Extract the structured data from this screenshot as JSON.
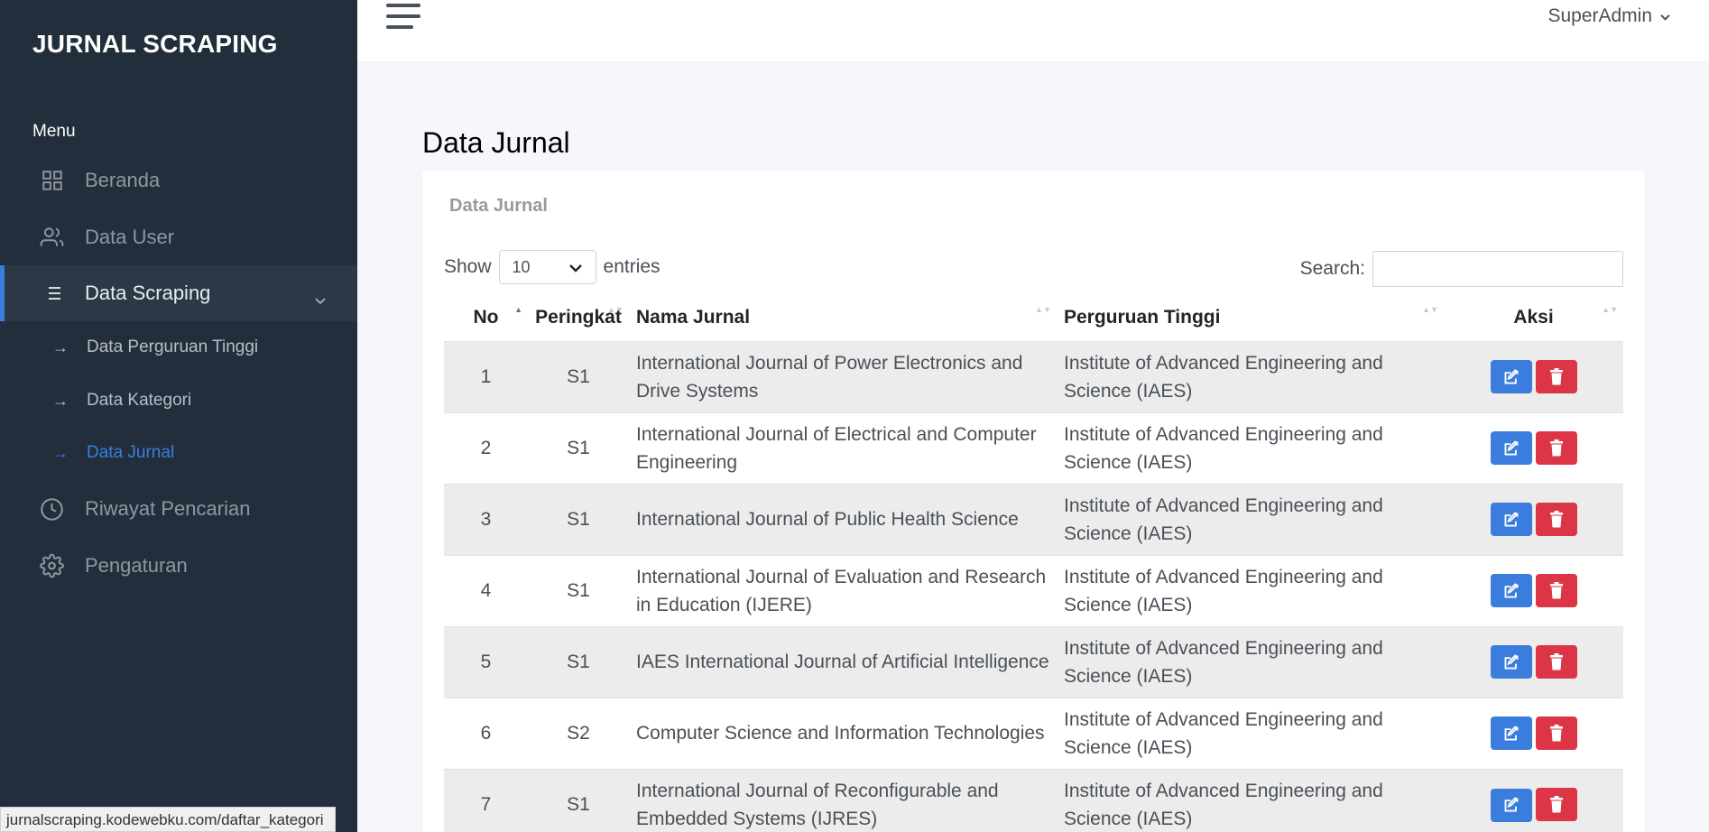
{
  "app": {
    "brand": "JURNAL SCRAPING",
    "user": "SuperAdmin"
  },
  "sidebar": {
    "header": "Menu",
    "items": [
      {
        "label": "Beranda",
        "icon": "grid-icon"
      },
      {
        "label": "Data User",
        "icon": "users-icon"
      },
      {
        "label": "Data Scraping",
        "icon": "list-icon",
        "active": true
      },
      {
        "label": "Riwayat Pencarian",
        "icon": "clock-icon"
      },
      {
        "label": "Pengaturan",
        "icon": "gear-icon"
      }
    ],
    "subitems": [
      {
        "label": "Data Perguruan Tinggi"
      },
      {
        "label": "Data Kategori"
      },
      {
        "label": "Data Jurnal",
        "active": true
      }
    ]
  },
  "page": {
    "title": "Data Jurnal",
    "card_title": "Data Jurnal"
  },
  "table_controls": {
    "show": "Show",
    "entries_value": "10",
    "entries": "entries",
    "search_label": "Search:",
    "search_value": ""
  },
  "table": {
    "headers": [
      "No",
      "Peringkat",
      "Nama Jurnal",
      "Perguruan Tinggi",
      "Aksi"
    ],
    "rows": [
      {
        "no": "1",
        "peringkat": "S1",
        "nama": "International Journal of Power Electronics and Drive Systems",
        "pt": "Institute of Advanced Engineering and Science (IAES)"
      },
      {
        "no": "2",
        "peringkat": "S1",
        "nama": "International Journal of Electrical and Computer Engineering",
        "pt": "Institute of Advanced Engineering and Science (IAES)"
      },
      {
        "no": "3",
        "peringkat": "S1",
        "nama": "International Journal of Public Health Science",
        "pt": "Institute of Advanced Engineering and Science (IAES)"
      },
      {
        "no": "4",
        "peringkat": "S1",
        "nama": "International Journal of Evaluation and Research in Education (IJERE)",
        "pt": "Institute of Advanced Engineering and Science (IAES)"
      },
      {
        "no": "5",
        "peringkat": "S1",
        "nama": "IAES International Journal of Artificial Intelligence",
        "pt": "Institute of Advanced Engineering and Science (IAES)"
      },
      {
        "no": "6",
        "peringkat": "S2",
        "nama": "Computer Science and Information Technologies",
        "pt": "Institute of Advanced Engineering and Science (IAES)"
      },
      {
        "no": "7",
        "peringkat": "S1",
        "nama": "International Journal of Reconfigurable and Embedded Systems (IJRES)",
        "pt": "Institute of Advanced Engineering and Science (IAES)"
      }
    ]
  },
  "status_bar": "jurnalscraping.kodewebku.com/daftar_kategori",
  "colors": {
    "sidebar": "#222e3c",
    "primary": "#3b7ddd",
    "danger": "#dc3545"
  }
}
